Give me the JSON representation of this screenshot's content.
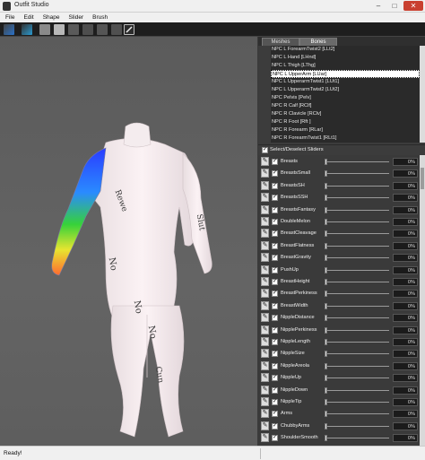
{
  "window": {
    "title": "Outfit Studio"
  },
  "menu": [
    "File",
    "Edit",
    "Shape",
    "Slider",
    "Brush"
  ],
  "toolbar": {
    "tools": [
      "select-tool",
      "transform-tool",
      "mask-tool",
      "inflate-tool",
      "deflate-tool",
      "move-tool",
      "smooth-tool",
      "weight-brush-tool"
    ]
  },
  "panel": {
    "tabs": [
      "Meshes",
      "Bones"
    ],
    "active_tab": "Bones",
    "bones": [
      "NPC L ForearmTwist2 [LLt2]",
      "NPC L Hand [LHnd]",
      "NPC L Thigh [LThg]",
      "NPC L UpperArm [LUar]",
      "NPC L UpperarmTwist1 [LUt1]",
      "NPC L UpperarmTwist2 [LUt2]",
      "NPC Pelvis [Pelv]",
      "NPC R Calf [RClf]",
      "NPC R Clavicle [RClv]",
      "NPC R Foot [Rft ]",
      "NPC R Forearm [RLar]",
      "NPC R ForearmTwist1 [RLt1]"
    ],
    "selected_bone_index": 3,
    "select_all_label": "Select/Deselect Sliders"
  },
  "sliders": [
    {
      "name": "Breasts",
      "value": "0%"
    },
    {
      "name": "BreastsSmall",
      "value": "0%"
    },
    {
      "name": "BreastsSH",
      "value": "0%"
    },
    {
      "name": "BreastsSSH",
      "value": "0%"
    },
    {
      "name": "BreastsFantasy",
      "value": "0%"
    },
    {
      "name": "DoubleMelon",
      "value": "0%"
    },
    {
      "name": "BreastCleavage",
      "value": "0%"
    },
    {
      "name": "BreastFlatness",
      "value": "0%"
    },
    {
      "name": "BreastGravity",
      "value": "0%"
    },
    {
      "name": "PushUp",
      "value": "0%"
    },
    {
      "name": "BreastHeight",
      "value": "0%"
    },
    {
      "name": "BreastPerkiness",
      "value": "0%"
    },
    {
      "name": "BreastWidth",
      "value": "0%"
    },
    {
      "name": "NippleDistance",
      "value": "0%"
    },
    {
      "name": "NipplePerkiness",
      "value": "0%"
    },
    {
      "name": "NippleLength",
      "value": "0%"
    },
    {
      "name": "NippleSize",
      "value": "0%"
    },
    {
      "name": "NippleAreola",
      "value": "0%"
    },
    {
      "name": "NippleUp",
      "value": "0%"
    },
    {
      "name": "NippleDown",
      "value": "0%"
    },
    {
      "name": "NippleTip",
      "value": "0%"
    },
    {
      "name": "Arms",
      "value": "0%"
    },
    {
      "name": "ChubbyArms",
      "value": "0%"
    },
    {
      "name": "ShoulderSmooth",
      "value": "0%"
    }
  ],
  "viewport": {
    "body_tattoo_text": [
      "Rewe",
      "No",
      "No",
      "No",
      "Cun",
      "Slut"
    ]
  },
  "status": {
    "text": "Ready!"
  },
  "colors": {
    "close_button": "#c94030",
    "viewport_bg": "#606060",
    "weight_hot": "#ff2a00",
    "weight_mid": "#36d23a",
    "weight_cold": "#2a3cff"
  }
}
